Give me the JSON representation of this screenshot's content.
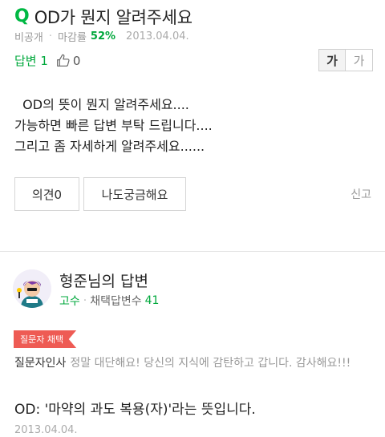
{
  "question": {
    "mark": "Q",
    "title": "OD가 뭔지 알려주세요",
    "visibility": "비공개",
    "closing_label": "마감률",
    "closing_rate": "52%",
    "date": "2013.04.04.",
    "answer_count_label": "답변 1",
    "like_count": "0",
    "body": "  OD의 뜻이 뭔지 알려주세요....\n가능하면 빠른 답변 부탁 드립니다....\n그리고 좀 자세하게 알려주세요......",
    "opinion_button": "의견0",
    "metoo_button": "나도궁금해요",
    "report_link": "신고"
  },
  "font_size_buttons": [
    "가",
    "가"
  ],
  "answer": {
    "answerer_name": "형준님의 답변",
    "grade": "고수",
    "adopt_label": "채택답변수",
    "adopt_count": "41",
    "badge": "질문자 채택",
    "greeting_label": "질문자인사",
    "greeting_message": "정말 대단해요! 당신의 지식에 감탄하고 갑니다. 감사해요!!!",
    "text": "OD: '마약의 과도 복용(자)'라는 뜻입니다.",
    "date": "2013.04.04."
  },
  "colors": {
    "accent_green": "#00a83c",
    "badge_red": "#ee5b54"
  },
  "icons": {
    "like": "thumbs-up-icon",
    "avatar": "user-avatar-icon"
  }
}
